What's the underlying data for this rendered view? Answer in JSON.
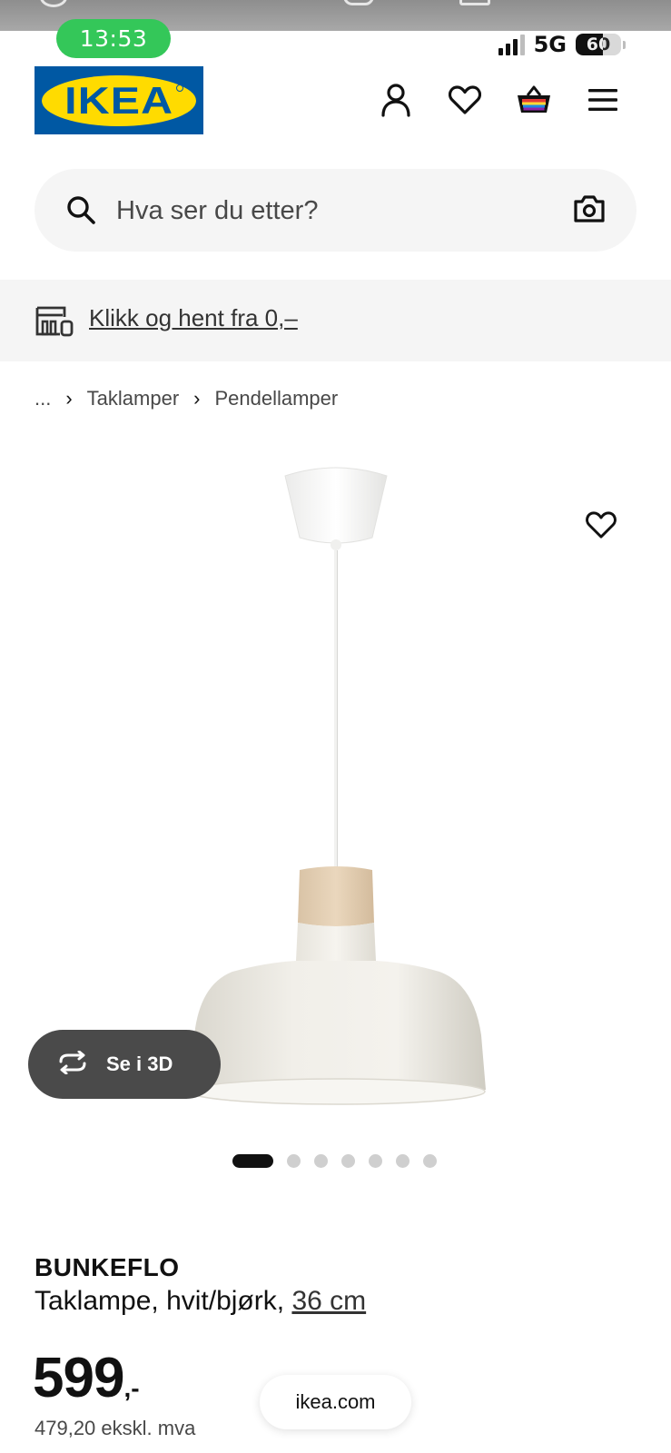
{
  "status_bar": {
    "time": "13:53",
    "network": "5G",
    "battery_percent": "60",
    "battery_level": 0.6,
    "signal_bars": 3
  },
  "header": {
    "logo_text": "IKEA",
    "icons": [
      "account-icon",
      "wishlist-icon",
      "cart-icon",
      "menu-icon"
    ]
  },
  "search": {
    "placeholder": "Hva ser du etter?"
  },
  "promo": {
    "text": "Klikk og hent fra 0,–"
  },
  "breadcrumb": {
    "items": [
      "...",
      "Taklamper",
      "Pendellamper"
    ]
  },
  "gallery": {
    "button_3d": "Se i 3D",
    "dot_count": 7,
    "active_dot": 0
  },
  "product": {
    "name": "BUNKEFLO",
    "description": "Taklampe, hvit/bjørk,",
    "size": "36 cm",
    "price": "599",
    "price_suffix": ",-",
    "price_ex_vat": "479,20 ekskl. mva"
  },
  "browser": {
    "domain": "ikea.com"
  },
  "colors": {
    "ikea_blue": "#0058a3",
    "ikea_yellow": "#ffdb00",
    "status_green": "#34c759",
    "pill_dark": "#4a4a4a"
  }
}
